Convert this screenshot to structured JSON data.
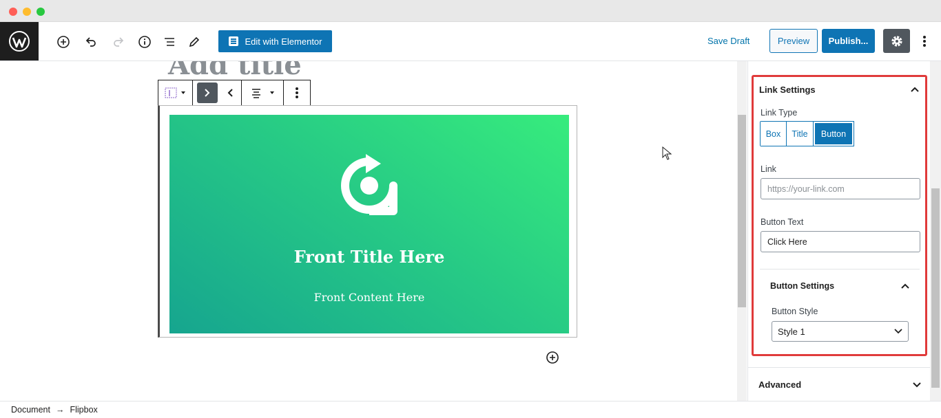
{
  "header": {
    "edit_with_elementor_label": "Edit with Elementor",
    "save_draft_label": "Save Draft",
    "preview_label": "Preview",
    "publish_label": "Publish..."
  },
  "editor": {
    "title_placeholder": "Add title",
    "flipbox": {
      "title": "Front Title Here",
      "content": "Front Content Here",
      "gradient_start": "#37ec7d",
      "gradient_end": "#16a58f"
    }
  },
  "sidebar": {
    "link_settings": {
      "heading": "Link Settings",
      "link_type_label": "Link Type",
      "link_type_options": [
        "Box",
        "Title",
        "Button"
      ],
      "link_type_selected": "Button",
      "link_label": "Link",
      "link_placeholder": "https://your-link.com",
      "button_text_label": "Button Text",
      "button_text_value": "Click Here",
      "button_settings": {
        "heading": "Button Settings",
        "button_style_label": "Button Style",
        "button_style_value": "Style 1"
      }
    },
    "advanced_label": "Advanced"
  },
  "footer": {
    "breadcrumb": [
      "Document",
      "Flipbox"
    ],
    "separator": "→"
  },
  "colors": {
    "primary": "#0e74b4",
    "highlight": "#e03a3a",
    "dark": "#1e1e1e"
  }
}
